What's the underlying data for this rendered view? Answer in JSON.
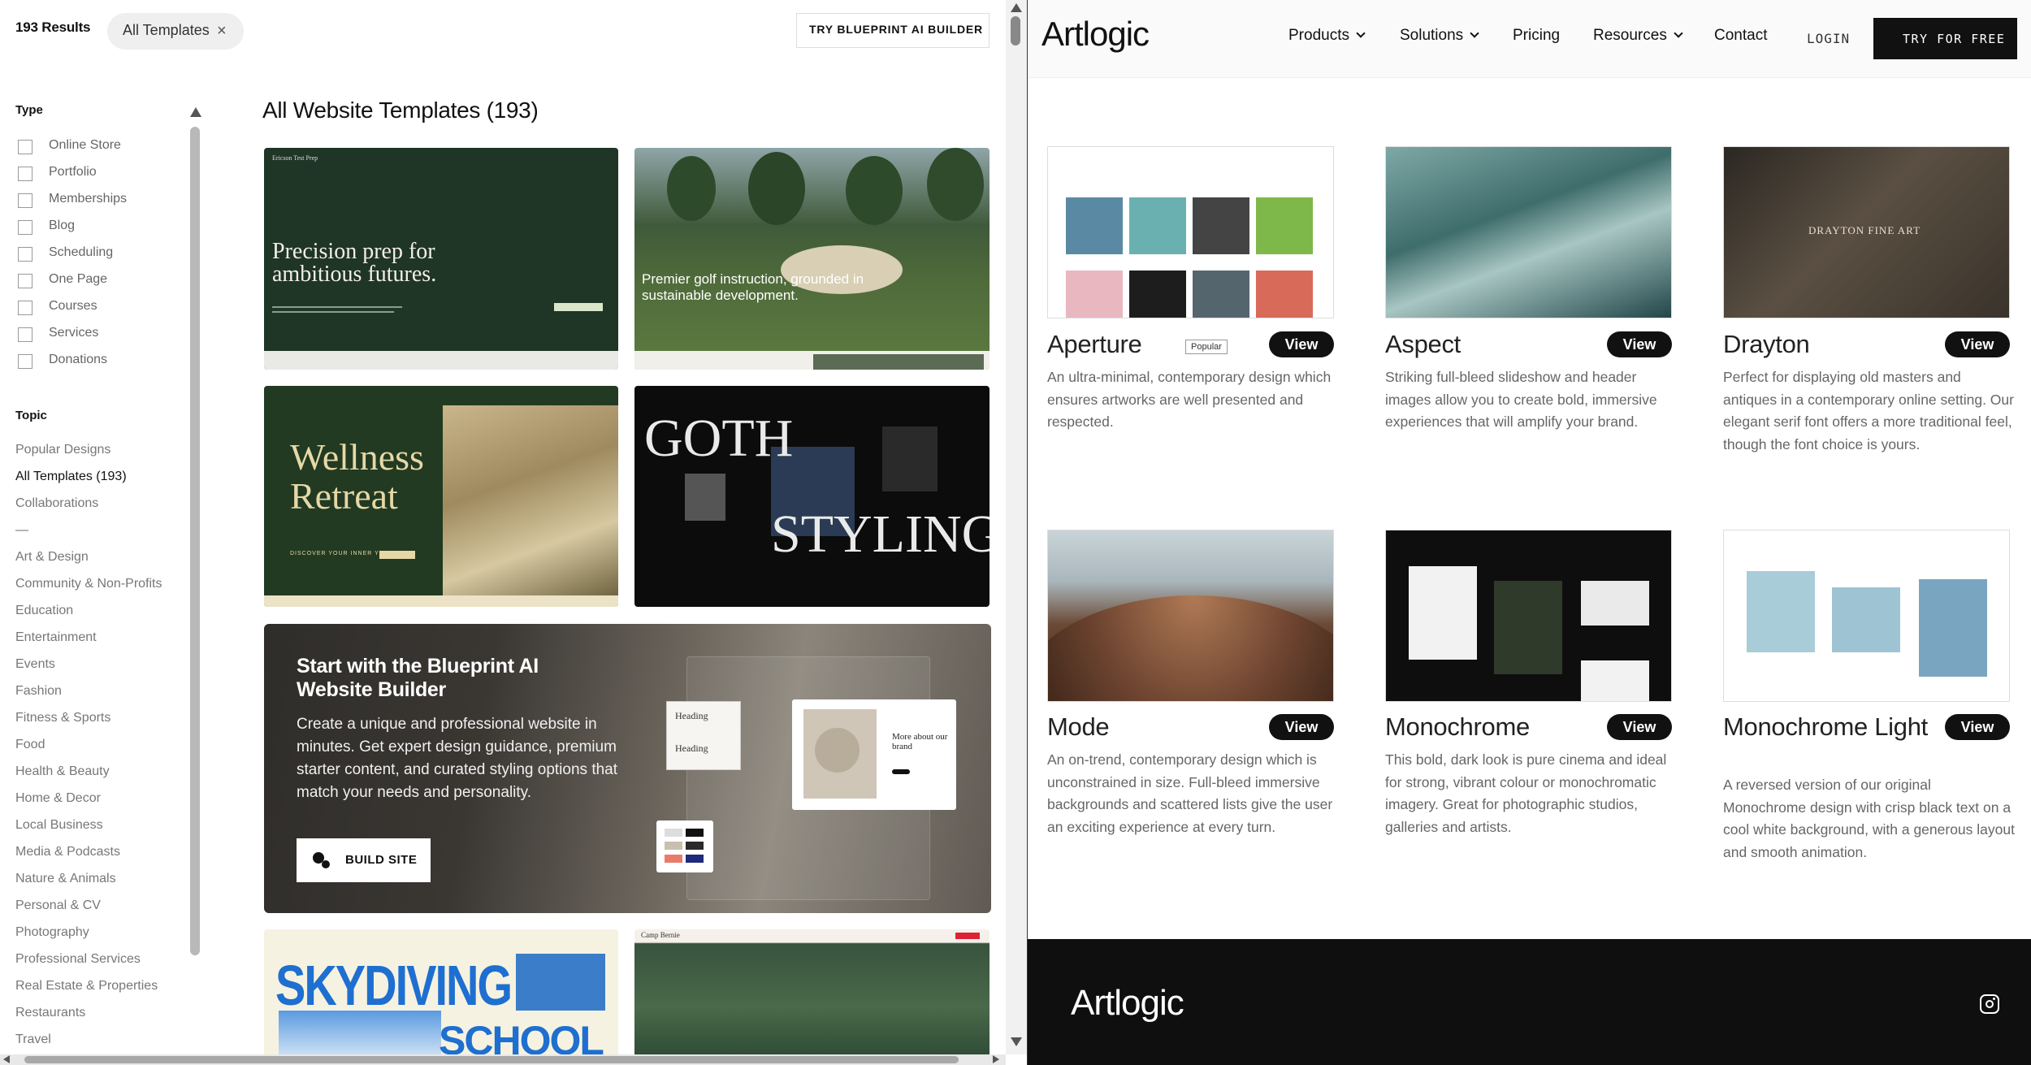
{
  "left": {
    "results": "193 Results",
    "chip": {
      "label": "All Templates",
      "close": "×"
    },
    "blueprint_button": "TRY BLUEPRINT AI BUILDER",
    "type_title": "Type",
    "types": [
      "Online Store",
      "Portfolio",
      "Memberships",
      "Blog",
      "Scheduling",
      "One Page",
      "Courses",
      "Services",
      "Donations"
    ],
    "topic_title": "Topic",
    "topics": [
      "Popular Designs",
      "All Templates (193)",
      "Collaborations",
      "—",
      "Art & Design",
      "Community & Non-Profits",
      "Education",
      "Entertainment",
      "Events",
      "Fashion",
      "Fitness & Sports",
      "Food",
      "Health & Beauty",
      "Home & Decor",
      "Local Business",
      "Media & Podcasts",
      "Nature & Animals",
      "Personal & CV",
      "Photography",
      "Professional Services",
      "Real Estate & Properties",
      "Restaurants",
      "Travel"
    ],
    "main_title": "All Website Templates (193)",
    "templates": {
      "t1": {
        "brand": "Ericson Test Prep",
        "headline": "Precision prep for ambitious futures."
      },
      "t2": {
        "headline": "Premier golf instruction, grounded in sustainable development."
      },
      "t3": {
        "headline": "Wellness Retreat",
        "sub": "DISCOVER YOUR INNER YOU"
      },
      "t4": {
        "word1": "GOTH",
        "word2": "STYLING"
      },
      "t5": {
        "headline": "SKYDIVING",
        "sub": "SCHOOL"
      },
      "t6": {
        "brand": "Camp Bernie"
      }
    },
    "promo": {
      "title": "Start with the Blueprint AI Website Builder",
      "description": "Create a unique and professional website in minutes. Get expert design guidance, premium starter content, and curated styling options that match your needs and personality.",
      "button": "BUILD SITE",
      "mock_heading1": "Heading",
      "mock_heading2": "Heading",
      "mock_more": "More about our brand"
    }
  },
  "right": {
    "logo": "Artlogic",
    "nav": {
      "products": "Products",
      "solutions": "Solutions",
      "pricing": "Pricing",
      "resources": "Resources",
      "contact": "Contact",
      "login": "LOGIN",
      "try": "TRY FOR FREE"
    },
    "cards": [
      {
        "name": "Aperture",
        "badge": "Popular",
        "view": "View",
        "desc": "An ultra-minimal, contemporary design which ensures artworks are well presented and respected."
      },
      {
        "name": "Aspect",
        "view": "View",
        "desc": "Striking full-bleed slideshow and header images allow you to create bold, immersive experiences that will amplify your brand."
      },
      {
        "name": "Drayton",
        "view": "View",
        "desc": "Perfect for displaying old masters and antiques in a contemporary online setting. Our elegant serif font offers a more traditional feel, though the font choice is yours.",
        "overlay": "DRAYTON FINE ART"
      },
      {
        "name": "Mode",
        "view": "View",
        "desc": "An on-trend, contemporary design which is unconstrained in size. Full-bleed immersive backgrounds and scattered lists give the user an exciting experience at every turn."
      },
      {
        "name": "Monochrome",
        "view": "View",
        "desc": "This bold, dark look is pure cinema and ideal for strong, vibrant colour or monochromatic imagery. Great for photographic studios, galleries and artists."
      },
      {
        "name": "Monochrome Light",
        "view": "View",
        "desc": "A reversed version of our original Monochrome design with crisp black text on a cool white background, with a generous layout and smooth animation."
      }
    ],
    "footer_logo": "Artlogic"
  }
}
